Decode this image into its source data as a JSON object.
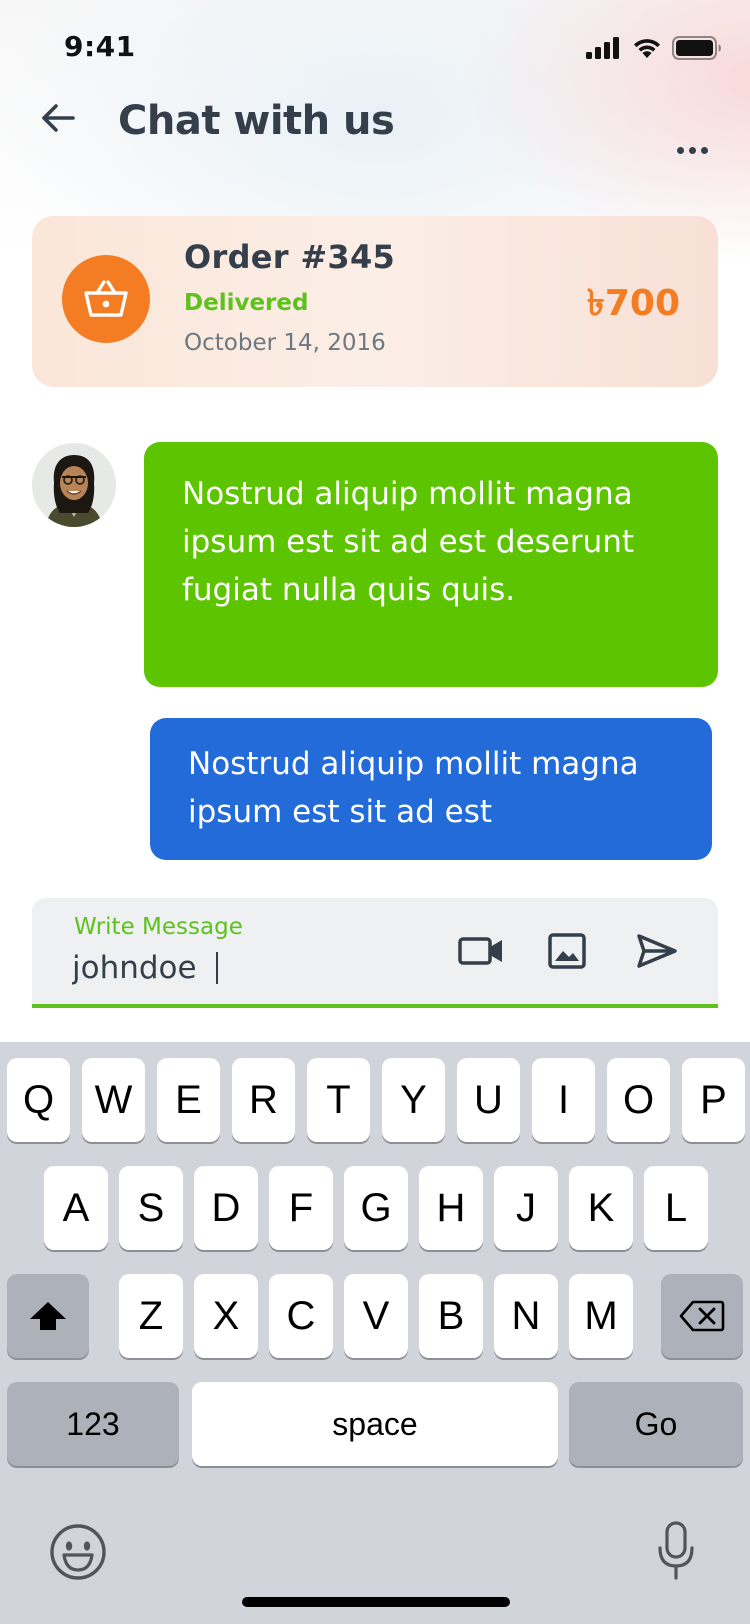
{
  "status_bar": {
    "time": "9:41",
    "icons": [
      "signal-icon",
      "wifi-icon",
      "battery-icon"
    ]
  },
  "header": {
    "title": "Chat with us",
    "back_icon": "arrow-left-icon",
    "more_icon": "more-horizontal-icon"
  },
  "order": {
    "title": "Order #345",
    "status": "Delivered",
    "date": "October 14, 2016",
    "price": "৳700",
    "icon": "basket-icon"
  },
  "chat": {
    "messages": [
      {
        "sender": "agent",
        "text": "Nostrud aliquip mollit magna ipsum est sit ad est deserunt fugiat nulla quis quis."
      },
      {
        "sender": "user",
        "text": "Nostrud aliquip mollit magna ipsum est sit ad est"
      }
    ]
  },
  "composer": {
    "label": "Write Message",
    "value": "johndoe",
    "actions": [
      "video-camera-icon",
      "image-icon",
      "send-icon"
    ]
  },
  "keyboard": {
    "row1": [
      "Q",
      "W",
      "E",
      "R",
      "T",
      "Y",
      "U",
      "I",
      "O",
      "P"
    ],
    "row2": [
      "A",
      "S",
      "D",
      "F",
      "G",
      "H",
      "J",
      "K",
      "L"
    ],
    "row3": [
      "Z",
      "X",
      "C",
      "V",
      "B",
      "N",
      "M"
    ],
    "numbers_label": "123",
    "space_label": "space",
    "go_label": "Go",
    "extra_icons": [
      "shift-icon",
      "backspace-icon",
      "emoji-icon",
      "microphone-icon"
    ]
  },
  "colors": {
    "accent_green": "#5EC11D",
    "accent_orange": "#F47C22",
    "bubble_blue": "#236BD9",
    "text_dark": "#343F4B"
  }
}
